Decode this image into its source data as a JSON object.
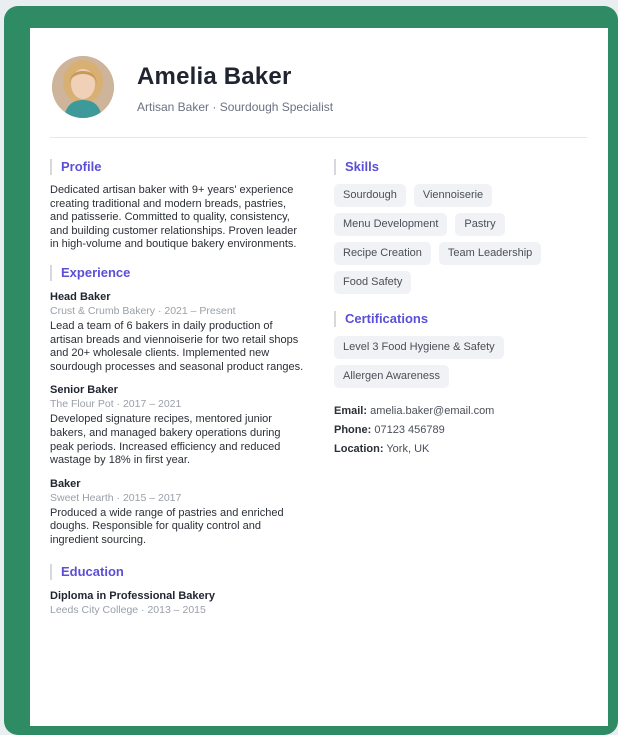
{
  "header": {
    "name": "Amelia Baker",
    "subtitle": "Artisan Baker · Sourdough Specialist"
  },
  "profile": {
    "title": "Profile",
    "text": "Dedicated artisan baker with 9+ years' experience creating traditional and modern breads, pastries, and patisserie. Committed to quality, consistency, and building customer relationships. Proven leader in high-volume and boutique bakery environments."
  },
  "experience": {
    "title": "Experience",
    "jobs": [
      {
        "title": "Head Baker",
        "meta": "Crust & Crumb Bakery · 2021 – Present",
        "description": "Lead a team of 6 bakers in daily production of artisan breads and viennoiserie for two retail shops and 20+ wholesale clients. Implemented new sourdough processes and seasonal product ranges."
      },
      {
        "title": "Senior Baker",
        "meta": "The Flour Pot · 2017 – 2021",
        "description": "Developed signature recipes, mentored junior bakers, and managed bakery operations during peak periods. Increased efficiency and reduced wastage by 18% in first year."
      },
      {
        "title": "Baker",
        "meta": "Sweet Hearth · 2015 – 2017",
        "description": "Produced a wide range of pastries and enriched doughs. Responsible for quality control and ingredient sourcing."
      }
    ]
  },
  "education": {
    "title": "Education",
    "degree": "Diploma in Professional Bakery",
    "meta": "Leeds City College · 2013 – 2015"
  },
  "skills": {
    "title": "Skills",
    "items": [
      "Sourdough",
      "Viennoiserie",
      "Menu Development",
      "Pastry",
      "Recipe Creation",
      "Team Leadership",
      "Food Safety"
    ]
  },
  "certifications": {
    "title": "Certifications",
    "items": [
      "Level 3 Food Hygiene & Safety",
      "Allergen Awareness"
    ]
  },
  "contact": {
    "email_label": "Email:",
    "email": "amelia.baker@email.com",
    "phone_label": "Phone:",
    "phone": "07123 456789",
    "location_label": "Location:",
    "location": "York, UK"
  },
  "colors": {
    "frame": "#2e8b63",
    "accent": "#5b4fd6"
  }
}
